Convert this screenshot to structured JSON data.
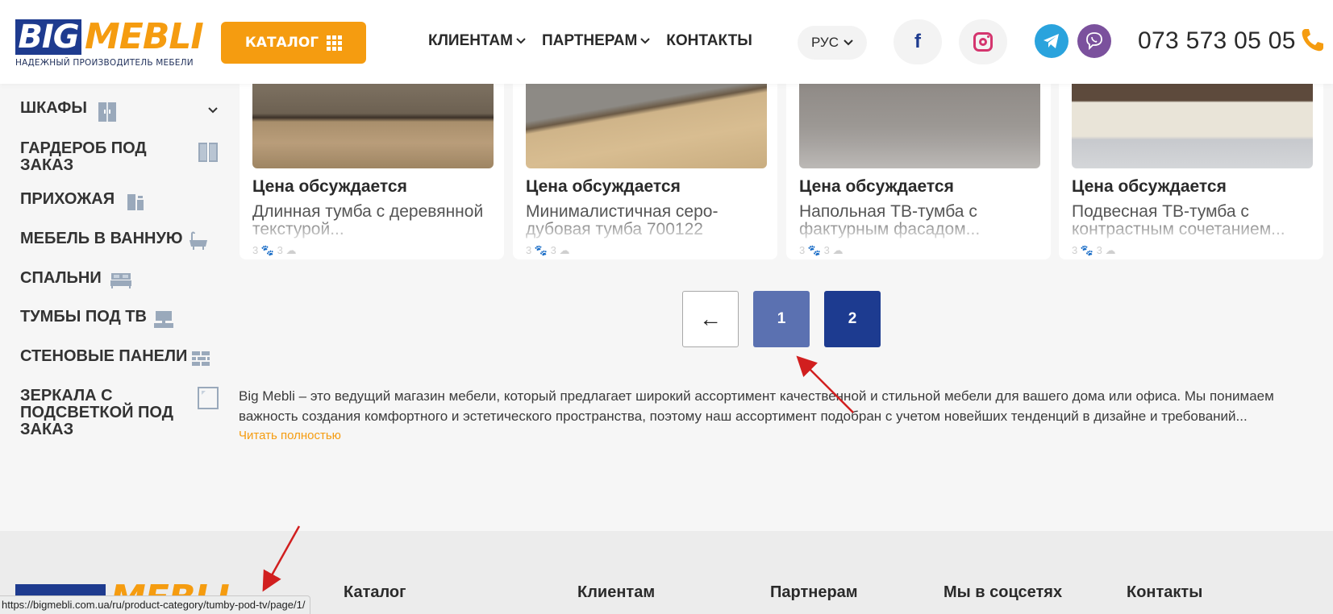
{
  "header": {
    "logo_big": "BIG",
    "logo_mebli": "MEBLI",
    "logo_tagline": "НАДЕЖНЫЙ ПРОИЗВОДИТЕЛЬ МЕБЕЛИ",
    "catalog_label": "КАТАЛОГ",
    "nav": [
      {
        "label": "КЛИЕНТАМ",
        "has_dropdown": true
      },
      {
        "label": "ПАРТНЕРАМ",
        "has_dropdown": true
      },
      {
        "label": "КОНТАКТЫ",
        "has_dropdown": false
      }
    ],
    "language": "РУС",
    "social": [
      "facebook-icon",
      "instagram-icon"
    ],
    "messengers": [
      "telegram-icon",
      "viber-icon"
    ],
    "phone": "073 573 05 05"
  },
  "sidebar": {
    "items": [
      {
        "label": "ШКАФЫ",
        "icon": "wardrobe-icon",
        "expandable": true
      },
      {
        "label": "ГАРДЕРОБ ПОД ЗАКАЗ",
        "icon": "closet-icon"
      },
      {
        "label": "ПРИХОЖАЯ",
        "icon": "hallway-icon"
      },
      {
        "label": "МЕБЕЛЬ В ВАННУЮ",
        "icon": "bathtub-icon"
      },
      {
        "label": "СПАЛЬНИ",
        "icon": "bed-icon"
      },
      {
        "label": "ТУМБЫ ПОД ТВ",
        "icon": "tv-stand-icon"
      },
      {
        "label": "СТЕНОВЫЕ ПАНЕЛИ",
        "icon": "wall-panel-icon"
      },
      {
        "label": "ЗЕРКАЛА С ПОДСВЕТКОЙ ПОД ЗАКАЗ",
        "icon": "mirror-icon"
      }
    ]
  },
  "products": [
    {
      "price": "Цена обсуждается",
      "name": "Длинная тумба с деревянной текстурой...",
      "meta": "3 🐾 3 ☁"
    },
    {
      "price": "Цена обсуждается",
      "name": "Минималистичная серо-дубовая тумба 700122",
      "meta": "3 🐾 3 ☁"
    },
    {
      "price": "Цена обсуждается",
      "name": "Напольная ТВ-тумба с фактурным фасадом...",
      "meta": "3 🐾 3 ☁"
    },
    {
      "price": "Цена обсуждается",
      "name": "Подвесная ТВ-тумба с контрастным сочетанием...",
      "meta": "3 🐾 3 ☁"
    }
  ],
  "pagination": {
    "prev": "←",
    "pages": [
      "1",
      "2"
    ],
    "current": "1"
  },
  "description": {
    "text": "Big Mebli – это ведущий магазин мебели, который предлагает широкий ассортимент качественной и стильной мебели для вашего дома или офиса. Мы понимаем важность создания комфортного и эстетического пространства, поэтому наш ассортимент подобран с учетом новейших тенденций в дизайне и требований...",
    "read_more": "Читать полностью"
  },
  "footer": {
    "columns": [
      "Каталог",
      "Клиентам",
      "Партнерам",
      "Мы в соцсетях",
      "Контакты"
    ]
  },
  "status_bar": {
    "url": "https://bigmebli.com.ua/ru/product-category/tumby-pod-tv/page/1/"
  },
  "colors": {
    "brand_orange": "#f59c10",
    "brand_blue": "#1e3b8f",
    "page_current": "#5b71b1",
    "page_other": "#1d3b90",
    "annotation_arrow": "#d11f1f"
  }
}
